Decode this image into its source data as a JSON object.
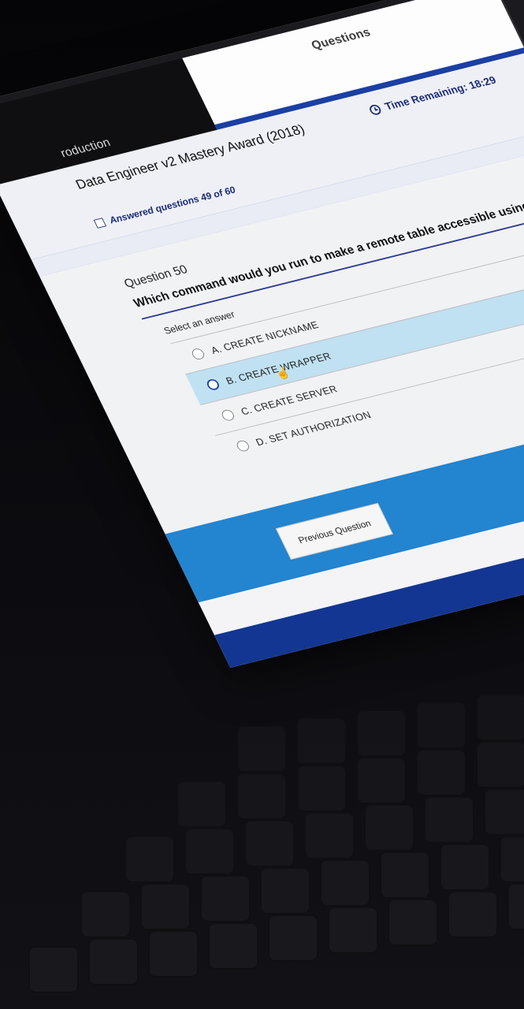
{
  "tabs": {
    "introduction_label": "roduction",
    "questions_label": "Questions"
  },
  "header": {
    "course_title": "Data Engineer v2 Mastery Award (2018)",
    "time_remaining": "Time Remaining: 18:29",
    "answered": "Answered questions 49 of 60",
    "answered_count": 49,
    "total_questions": 60,
    "progress_fraction": 0.82
  },
  "question": {
    "number_label": "Question 50",
    "text": "Which command would you run to make a remote table accessible using a",
    "select_prompt": "Select an answer",
    "answers": [
      {
        "label": "A. CREATE NICKNAME",
        "selected": false
      },
      {
        "label": "B. CREATE WRAPPER",
        "selected": true
      },
      {
        "label": "C. CREATE SERVER",
        "selected": false
      },
      {
        "label": "D. SET AUTHORIZATION",
        "selected": false
      }
    ]
  },
  "footer": {
    "previous_button": "Previous Question"
  },
  "colors": {
    "accent_blue": "#1b3fa3",
    "band_blue": "#2384cf",
    "selected_row": "#bfe1f2"
  },
  "icons": {
    "timer": "clock-icon",
    "answered": "checkbox-icon",
    "pointer": "hand-cursor-icon"
  }
}
